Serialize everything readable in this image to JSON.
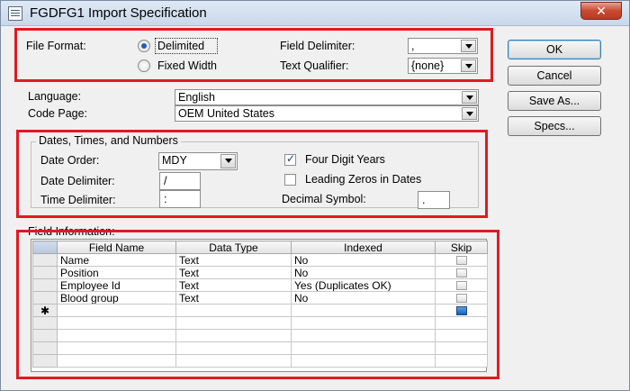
{
  "window": {
    "title": "FGDFG1 Import Specification",
    "close_glyph": "✕"
  },
  "file_format": {
    "label": "File Format:",
    "delimited_label": "Delimited",
    "fixed_width_label": "Fixed Width",
    "selected": "Delimited"
  },
  "field_delimiter": {
    "label": "Field Delimiter:",
    "value": ","
  },
  "text_qualifier": {
    "label": "Text Qualifier:",
    "value": "{none}"
  },
  "language": {
    "label": "Language:",
    "value": "English"
  },
  "code_page": {
    "label": "Code Page:",
    "value": "OEM United States"
  },
  "buttons": {
    "ok": "OK",
    "cancel": "Cancel",
    "save_as": "Save As...",
    "specs": "Specs..."
  },
  "dates": {
    "group_title": "Dates, Times, and Numbers",
    "date_order_label": "Date Order:",
    "date_order_value": "MDY",
    "date_delimiter_label": "Date Delimiter:",
    "date_delimiter_value": "/",
    "time_delimiter_label": "Time Delimiter:",
    "time_delimiter_value": ":",
    "four_digit_years_label": "Four Digit Years",
    "four_digit_years_checked": true,
    "leading_zeros_label": "Leading Zeros in Dates",
    "leading_zeros_checked": false,
    "decimal_symbol_label": "Decimal Symbol:",
    "decimal_symbol_value": "."
  },
  "field_information": {
    "label": "Field Information:",
    "columns": [
      "Field Name",
      "Data Type",
      "Indexed",
      "Skip"
    ],
    "rows": [
      {
        "name": "Name",
        "type": "Text",
        "indexed": "No",
        "skip": false
      },
      {
        "name": "Position",
        "type": "Text",
        "indexed": "No",
        "skip": false
      },
      {
        "name": "Employee Id",
        "type": "Text",
        "indexed": "Yes (Duplicates OK)",
        "skip": false
      },
      {
        "name": "Blood group",
        "type": "Text",
        "indexed": "No",
        "skip": false
      }
    ],
    "new_row_marker": "✱"
  },
  "colors": {
    "highlight_border": "#e01a22",
    "window_bg": "#f0f0f0"
  }
}
